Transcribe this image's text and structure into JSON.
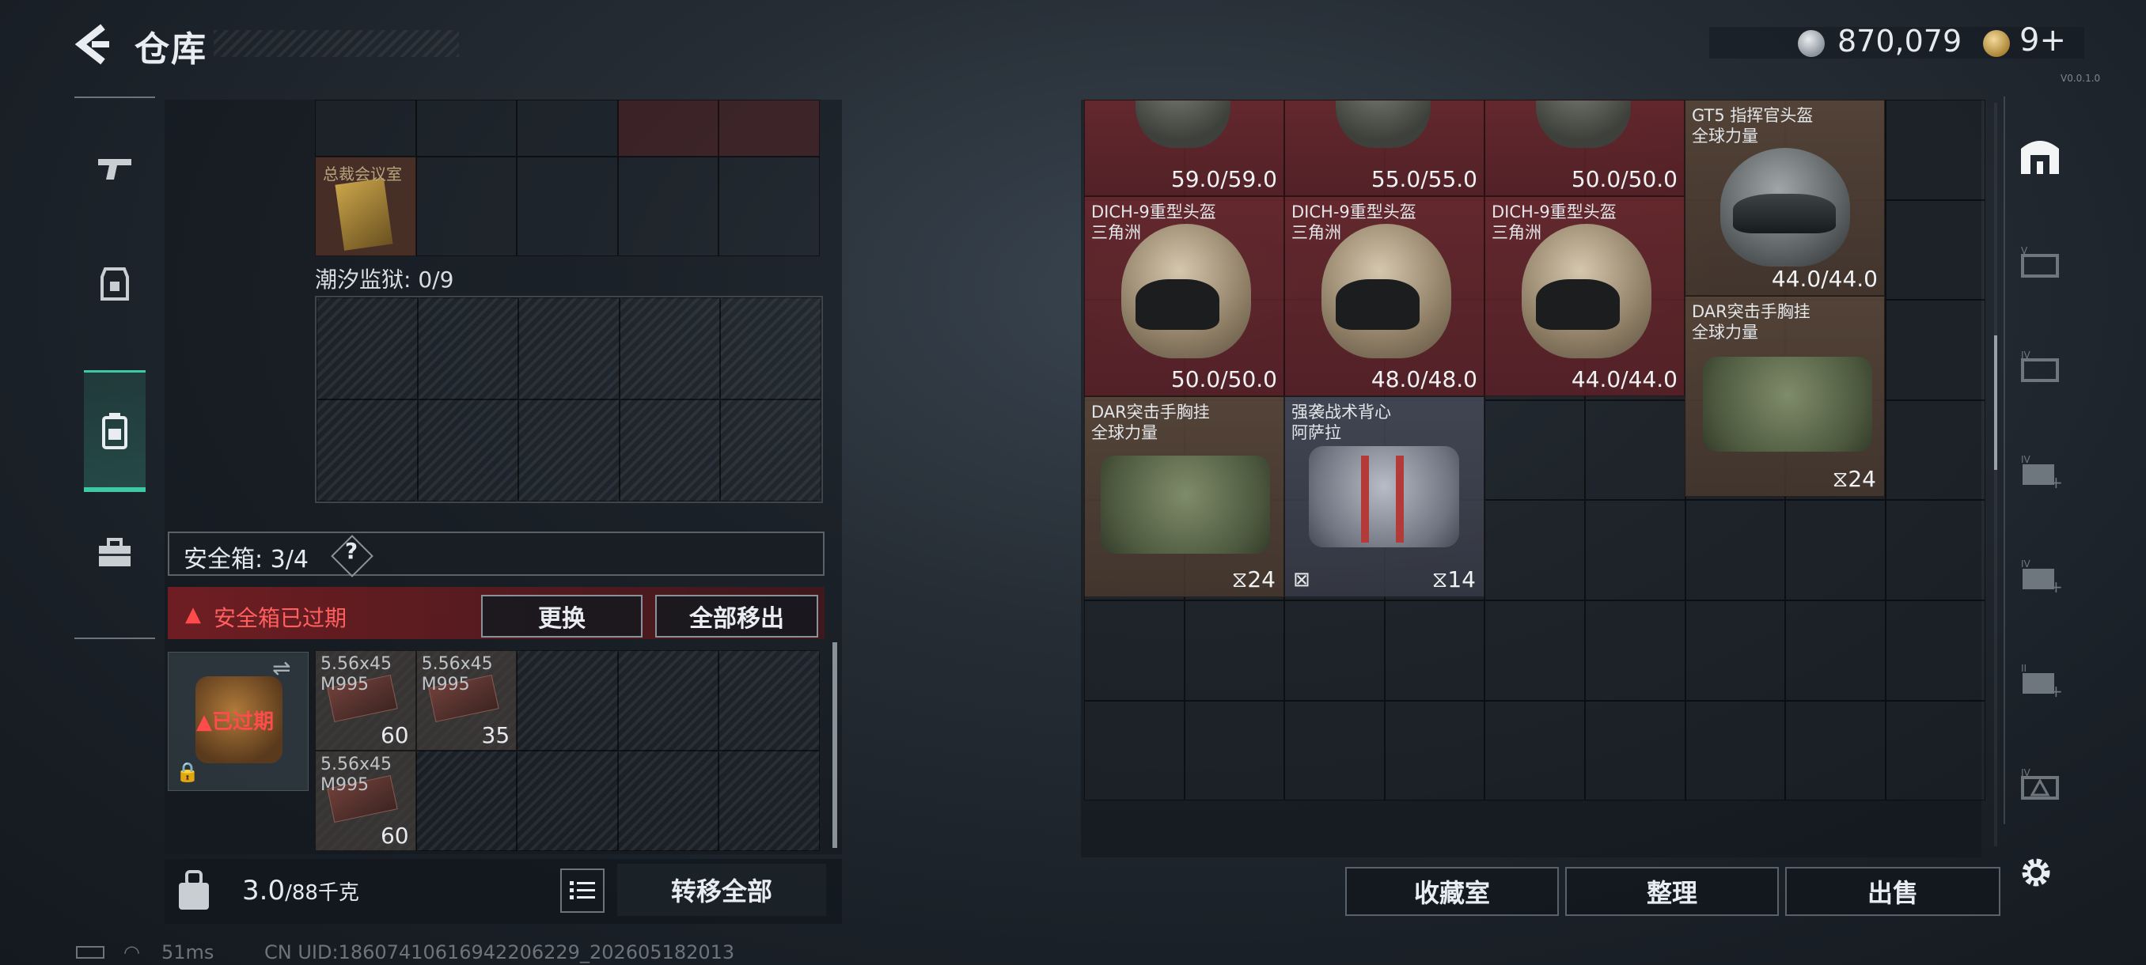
{
  "header": {
    "title": "仓库",
    "coins": "870,079",
    "tokens": "9+",
    "version": "V0.0.1.0"
  },
  "left_panel": {
    "stash_room_label": "总裁会议室",
    "tide_prison_label": "潮汐监狱: 0/9",
    "safebox_label": "安全箱: 3/4",
    "help_mark": "?",
    "expired_warning": "安全箱已过期",
    "replace_button": "更换",
    "move_all_button": "全部移出",
    "safebox_status": "已过期",
    "ammo": [
      {
        "name": "5.56x45\nM995",
        "count": "60"
      },
      {
        "name": "5.56x45\nM995",
        "count": "35"
      },
      {
        "name": "5.56x45\nM995",
        "count": "60"
      }
    ]
  },
  "bottom_left": {
    "weight_value": "3.0",
    "weight_capacity": "/88千克",
    "transfer_all_button": "转移全部"
  },
  "status_bar": {
    "ping": "51ms",
    "uid": "CN UID:18607410616942206229_202605182013"
  },
  "items": {
    "top_row": [
      {
        "durability": "59.0/59.0"
      },
      {
        "durability": "55.0/55.0"
      },
      {
        "durability": "50.0/50.0"
      }
    ],
    "gt5": {
      "name": "GT5 指挥官头盔",
      "origin": "全球力量",
      "durability": "44.0/44.0"
    },
    "dich": [
      {
        "name": "DICH-9重型头盔",
        "origin": "三角洲",
        "durability": "50.0/50.0"
      },
      {
        "name": "DICH-9重型头盔",
        "origin": "三角洲",
        "durability": "48.0/48.0"
      },
      {
        "name": "DICH-9重型头盔",
        "origin": "三角洲",
        "durability": "44.0/44.0"
      }
    ],
    "dar_right": {
      "name": "DAR突击手胸挂",
      "origin": "全球力量",
      "count": "24"
    },
    "dar_left": {
      "name": "DAR突击手胸挂",
      "origin": "全球力量",
      "count": "24"
    },
    "vest": {
      "name": "强袭战术背心",
      "origin": "阿萨拉",
      "count": "14"
    }
  },
  "bottom_right": {
    "collection_button": "收藏室",
    "arrange_button": "整理",
    "sell_button": "出售"
  },
  "colors": {
    "accent_teal": "#3ec9a4",
    "expired_red": "#ff4b4b",
    "item_red": "#6e282d",
    "item_brown": "#5c483a"
  }
}
